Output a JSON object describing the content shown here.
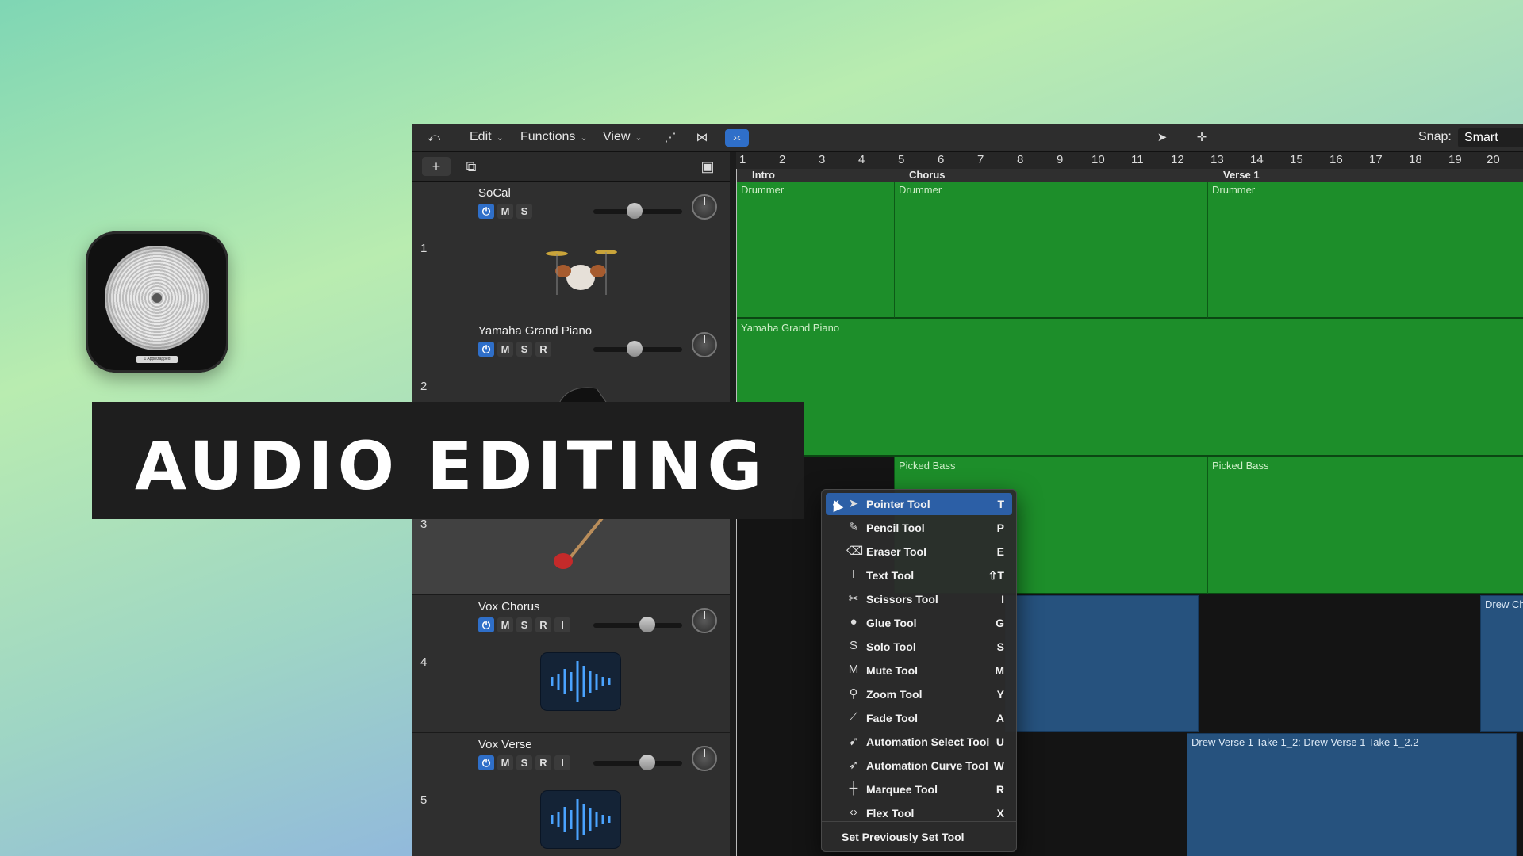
{
  "app_icon": {
    "label": "1 Applezapped"
  },
  "banner": {
    "text": "AUDIO EDITING"
  },
  "toolbar": {
    "menus": [
      "Edit",
      "Functions",
      "View"
    ],
    "snap_label": "Snap:",
    "snap_value": "Smart"
  },
  "ruler": [
    "1",
    "2",
    "3",
    "4",
    "5",
    "6",
    "7",
    "8",
    "9",
    "10",
    "11",
    "12",
    "13",
    "14",
    "15",
    "16",
    "17",
    "18",
    "19",
    "20"
  ],
  "markers": [
    "Intro",
    "Chorus",
    "Verse 1"
  ],
  "tracks": [
    {
      "num": "1",
      "name": "SoCal",
      "buttons": [
        "M",
        "S"
      ]
    },
    {
      "num": "2",
      "name": "Yamaha Grand Piano",
      "buttons": [
        "M",
        "S",
        "R"
      ]
    },
    {
      "num": "3",
      "name": "",
      "buttons": []
    },
    {
      "num": "4",
      "name": "Vox Chorus",
      "buttons": [
        "M",
        "S",
        "R",
        "I"
      ]
    },
    {
      "num": "5",
      "name": "Vox Verse",
      "buttons": [
        "M",
        "S",
        "R",
        "I"
      ]
    }
  ],
  "regions": {
    "drummer": "Drummer",
    "piano": "Yamaha Grand Piano",
    "bass": "Picked Bass",
    "vox_chorus": "Drew Ch",
    "vox_verse": "Drew Verse 1 Take 1_2: Drew Verse 1 Take 1_2.2"
  },
  "tool_menu": {
    "items": [
      {
        "label": "Pointer Tool",
        "shortcut": "T",
        "icon": "pointer-icon"
      },
      {
        "label": "Pencil Tool",
        "shortcut": "P",
        "icon": "pencil-icon"
      },
      {
        "label": "Eraser Tool",
        "shortcut": "E",
        "icon": "eraser-icon"
      },
      {
        "label": "Text Tool",
        "shortcut": "⇧T",
        "icon": "text-cursor-icon"
      },
      {
        "label": "Scissors Tool",
        "shortcut": "I",
        "icon": "scissors-icon"
      },
      {
        "label": "Glue Tool",
        "shortcut": "G",
        "icon": "glue-icon"
      },
      {
        "label": "Solo Tool",
        "shortcut": "S",
        "icon": "solo-icon"
      },
      {
        "label": "Mute Tool",
        "shortcut": "M",
        "icon": "mute-icon"
      },
      {
        "label": "Zoom Tool",
        "shortcut": "Y",
        "icon": "magnifier-icon"
      },
      {
        "label": "Fade Tool",
        "shortcut": "A",
        "icon": "fade-icon"
      },
      {
        "label": "Automation Select Tool",
        "shortcut": "U",
        "icon": "automation-select-icon"
      },
      {
        "label": "Automation Curve Tool",
        "shortcut": "W",
        "icon": "automation-curve-icon"
      },
      {
        "label": "Marquee Tool",
        "shortcut": "R",
        "icon": "crosshair-icon"
      },
      {
        "label": "Flex Tool",
        "shortcut": "X",
        "icon": "flex-icon"
      }
    ],
    "footer": "Set Previously Set Tool"
  }
}
